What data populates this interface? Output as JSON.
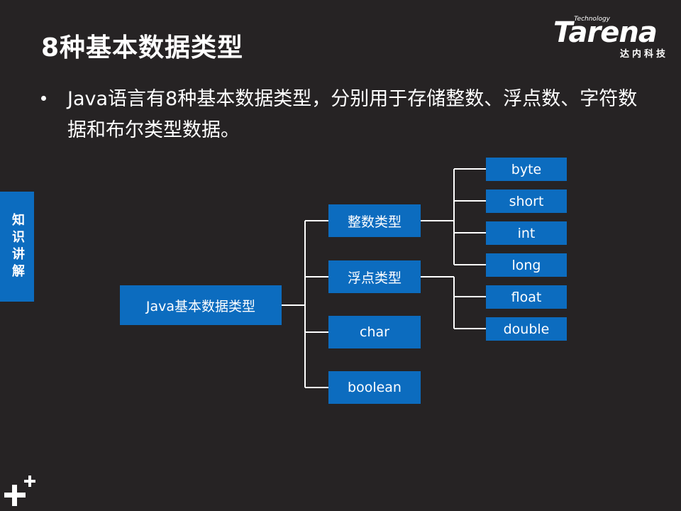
{
  "slide": {
    "title": "8种基本数据类型",
    "bullet": "Java语言有8种基本数据类型，分别用于存储整数、浮点数、字符数据和布尔类型数据。",
    "side_tab": "知识讲解"
  },
  "logo": {
    "word": "Tarena",
    "tagline": "Technology",
    "chinese": "达内科技"
  },
  "diagram": {
    "root": "Java基本数据类型",
    "categories": [
      "整数类型",
      "浮点类型",
      "char",
      "boolean"
    ],
    "integer_types": [
      "byte",
      "short",
      "int",
      "long"
    ],
    "float_types": [
      "float",
      "double"
    ]
  },
  "colors": {
    "background": "#262324",
    "box": "#0c6cbf",
    "text": "#ffffff",
    "connector": "#ffffff"
  }
}
